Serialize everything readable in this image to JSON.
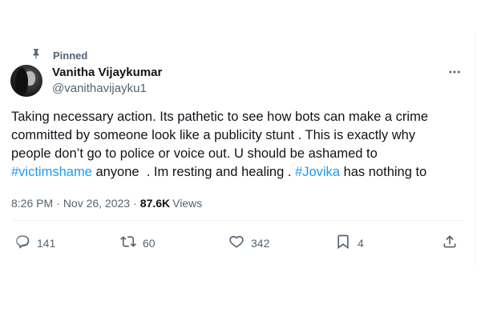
{
  "pinned": {
    "label": "Pinned",
    "icon": "pin-icon"
  },
  "author": {
    "name": "Vanitha Vijaykumar",
    "handle": "@vanithavijayku1",
    "avatar_icon": "avatar"
  },
  "tweet": {
    "lines": [
      [
        {
          "text": "Taking necessary action. Its pathetic to see how bots can make a crime",
          "type": "text"
        }
      ],
      [
        {
          "text": "committed by someone look like a publicity stunt . This is exactly why",
          "type": "text"
        }
      ],
      [
        {
          "text": "people don’t go to police or voice out. U should be ashamed to",
          "type": "text"
        }
      ],
      [
        {
          "text": "#victimshame",
          "type": "hashtag"
        },
        {
          "text": " anyone  . Im resting and healing . ",
          "type": "text"
        },
        {
          "text": "#Jovika",
          "type": "hashtag"
        },
        {
          "text": " has nothing to",
          "type": "text"
        }
      ]
    ]
  },
  "meta": {
    "time": "8:26 PM",
    "separator": "·",
    "date": "Nov 26, 2023",
    "views_count": "87.6K",
    "views_label": "Views"
  },
  "actions": {
    "reply_count": "141",
    "retweet_count": "60",
    "like_count": "342",
    "bookmark_count": "4"
  },
  "colors": {
    "text": "#0f1419",
    "secondary": "#536471",
    "link": "#1d9bf0",
    "divider": "#eff3f4"
  }
}
